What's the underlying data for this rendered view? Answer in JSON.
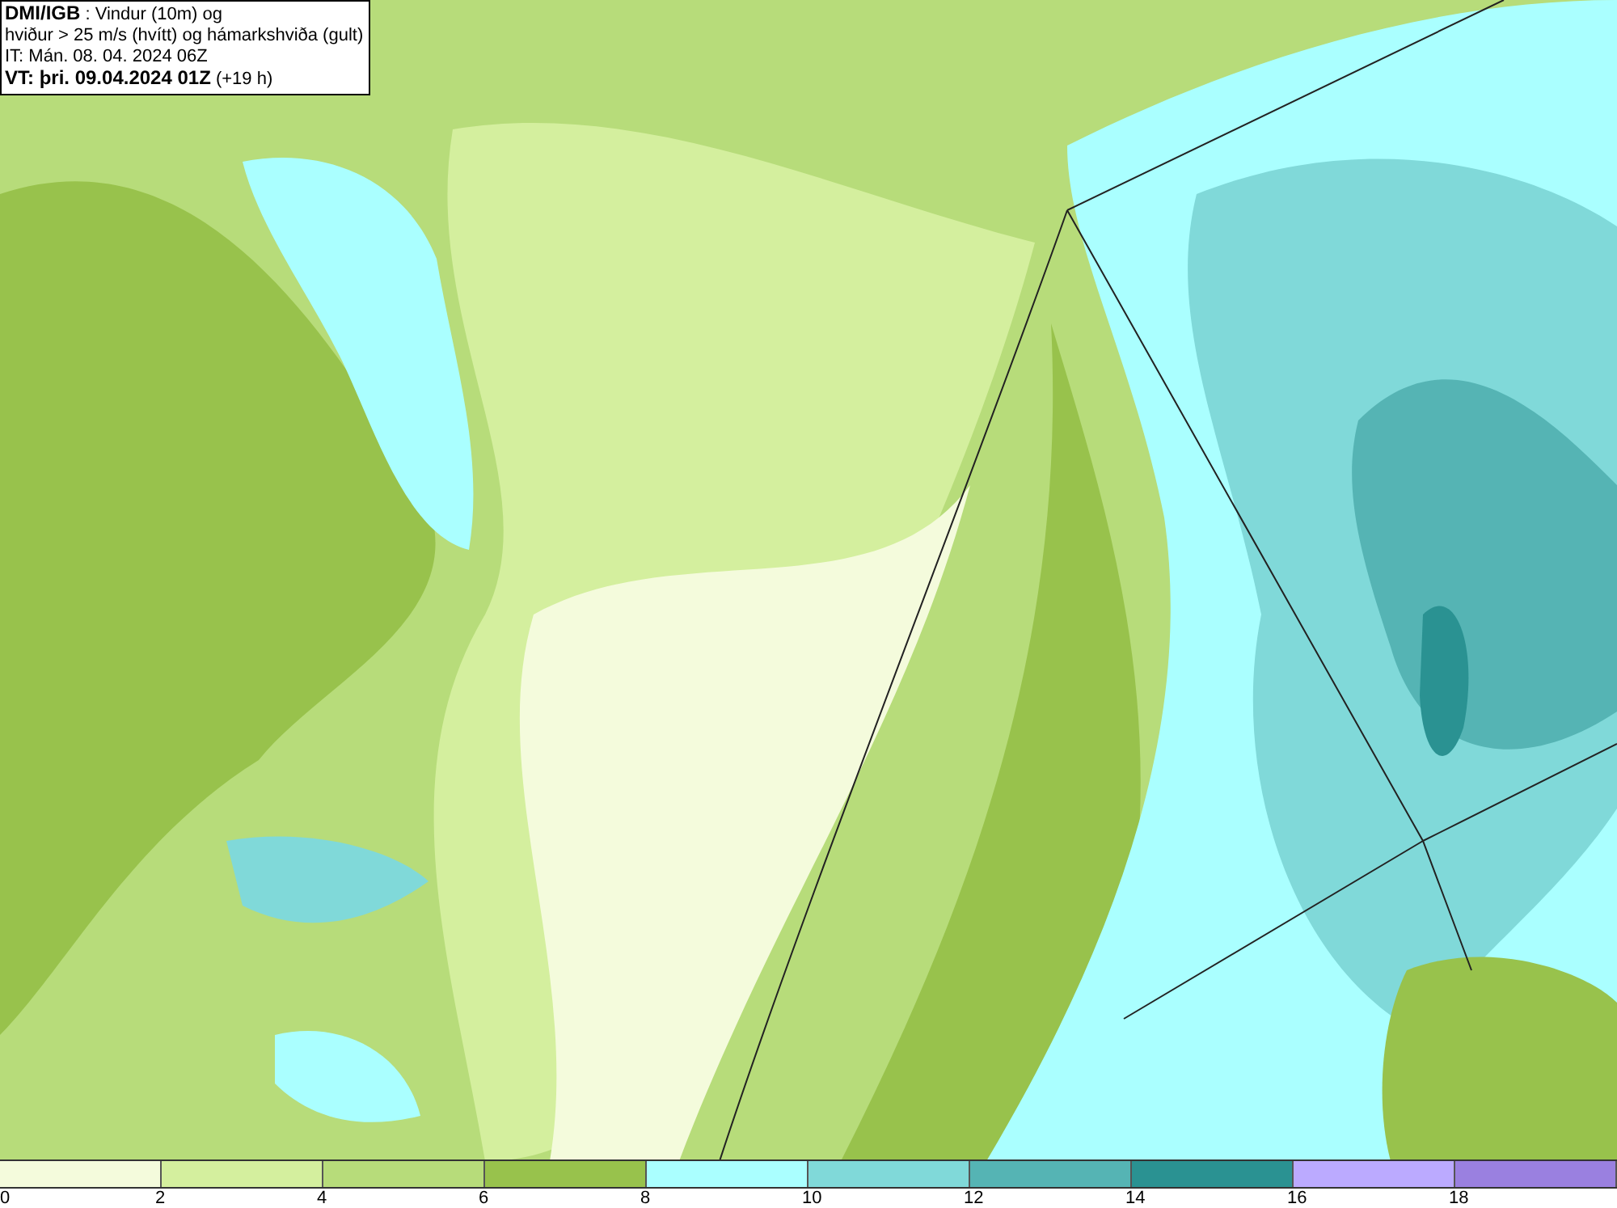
{
  "title_box": {
    "lines": [
      "**DMI/IGB** : Vindur (10m) og",
      "hviður > 25 m/s (hvítt) og hámarkshviða (gult)",
      "IT: Mán. 08. 04. 2024 06Z",
      "**VT: þri. 09.04.2024 01Z** (+19 h)"
    ]
  },
  "legend": {
    "bins": [
      {
        "color": "#f4fbdc"
      },
      {
        "color": "#d4ef9e"
      },
      {
        "color": "#b7dc7a"
      },
      {
        "color": "#98c24c"
      },
      {
        "color": "#aaffff"
      },
      {
        "color": "#80d9d9"
      },
      {
        "color": "#55b4b4"
      },
      {
        "color": "#2a9292"
      },
      {
        "color": "#bbaaff"
      },
      {
        "color": "#9a80e0"
      }
    ],
    "ticks": [
      "0",
      "2",
      "4",
      "6",
      "8",
      "10",
      "12",
      "14",
      "16",
      "18"
    ]
  }
}
